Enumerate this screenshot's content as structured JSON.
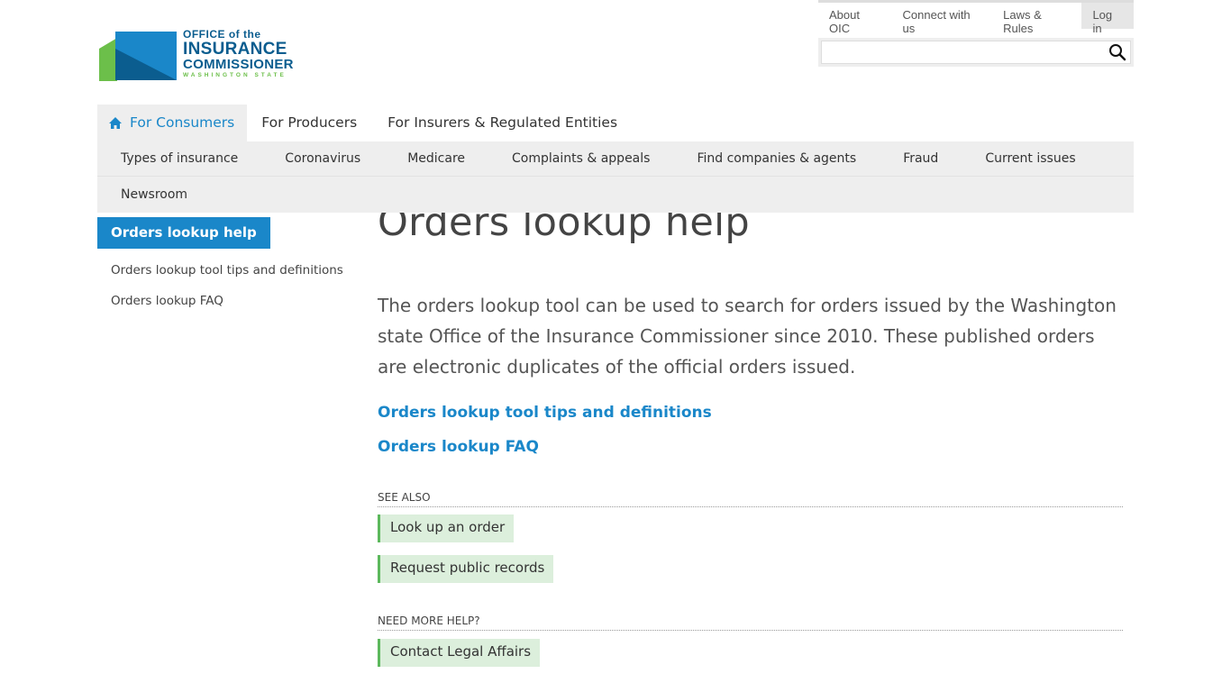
{
  "utility_nav": {
    "items": [
      {
        "label": "About OIC"
      },
      {
        "label": "Connect with us"
      },
      {
        "label": "Laws & Rules"
      },
      {
        "label": "Log in"
      }
    ]
  },
  "search": {
    "placeholder": "",
    "value": ""
  },
  "logo": {
    "line1": "OFFICE of the",
    "line2": "INSURANCE",
    "line3": "COMMISSIONER",
    "line4": "WASHINGTON STATE",
    "colors": {
      "blue": "#1a87c9",
      "dark_blue": "#0b5d8f",
      "green": "#6cbf4a"
    }
  },
  "primary_nav": {
    "items": [
      {
        "label": "For Consumers",
        "active": true,
        "icon": "home-icon"
      },
      {
        "label": "For Producers"
      },
      {
        "label": "For Insurers & Regulated Entities"
      }
    ]
  },
  "secondary_nav": {
    "row1": [
      "Types of insurance",
      "Coronavirus",
      "Medicare",
      "Complaints & appeals",
      "Find companies & agents",
      "Fraud",
      "Current issues"
    ],
    "row2": [
      "Newsroom"
    ]
  },
  "sidebar": {
    "active": "Orders lookup help",
    "links": [
      "Orders lookup tool tips and definitions",
      "Orders lookup FAQ"
    ]
  },
  "main": {
    "title": "Orders lookup help",
    "intro": "The orders lookup tool can be used to search for orders issued by the Washington state Office of the Insurance Commissioner since 2010. These published orders are electronic duplicates of the official orders issued.",
    "links": [
      "Orders lookup tool tips and definitions",
      "Orders lookup FAQ"
    ],
    "see_also": {
      "label": "SEE ALSO",
      "items": [
        "Look up an order",
        "Request public records"
      ]
    },
    "need_help": {
      "label": "NEED MORE HELP?",
      "items": [
        "Contact Legal Affairs"
      ]
    }
  },
  "colors": {
    "accent": "#1a87c9",
    "pill_bg": "#dcefdc",
    "pill_border": "#5cb85c",
    "nav_bg": "#eeeeee"
  }
}
